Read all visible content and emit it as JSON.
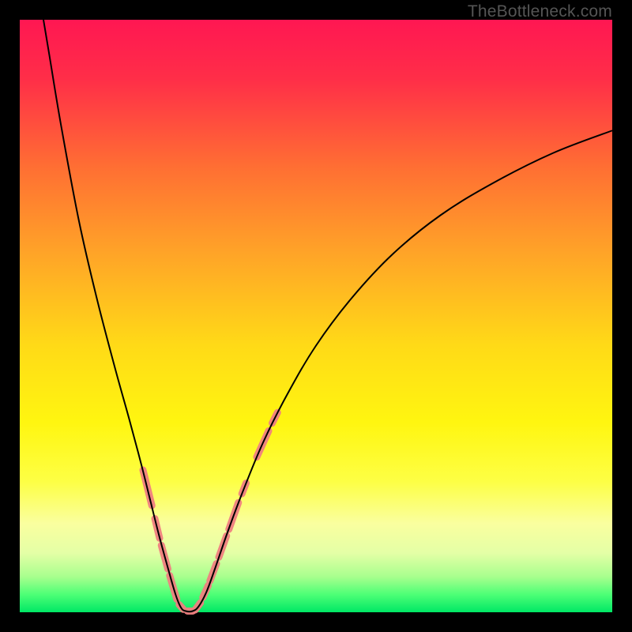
{
  "watermark": "TheBottleneck.com",
  "chart_data": {
    "type": "line",
    "title": "",
    "xlabel": "",
    "ylabel": "",
    "xlim": [
      0,
      100
    ],
    "ylim": [
      0,
      100
    ],
    "gradient_stops": [
      {
        "offset": 0.0,
        "color": "#ff1752"
      },
      {
        "offset": 0.1,
        "color": "#ff2e48"
      },
      {
        "offset": 0.25,
        "color": "#ff6f33"
      },
      {
        "offset": 0.4,
        "color": "#ffa627"
      },
      {
        "offset": 0.55,
        "color": "#ffda17"
      },
      {
        "offset": 0.68,
        "color": "#fff610"
      },
      {
        "offset": 0.78,
        "color": "#fdff45"
      },
      {
        "offset": 0.85,
        "color": "#faff9f"
      },
      {
        "offset": 0.9,
        "color": "#e4ffa6"
      },
      {
        "offset": 0.94,
        "color": "#a8ff8e"
      },
      {
        "offset": 0.97,
        "color": "#4dff76"
      },
      {
        "offset": 1.0,
        "color": "#00e765"
      }
    ],
    "series": [
      {
        "name": "bottleneck-curve",
        "stroke": "#000000",
        "stroke_width": 2,
        "points": [
          {
            "x": 4.0,
            "y": 100.0
          },
          {
            "x": 5.0,
            "y": 94.0
          },
          {
            "x": 7.0,
            "y": 82.0
          },
          {
            "x": 10.0,
            "y": 66.0
          },
          {
            "x": 13.0,
            "y": 53.0
          },
          {
            "x": 16.0,
            "y": 41.5
          },
          {
            "x": 18.5,
            "y": 32.5
          },
          {
            "x": 20.5,
            "y": 25.0
          },
          {
            "x": 22.0,
            "y": 19.0
          },
          {
            "x": 23.5,
            "y": 13.0
          },
          {
            "x": 25.0,
            "y": 7.5
          },
          {
            "x": 26.3,
            "y": 3.0
          },
          {
            "x": 27.2,
            "y": 0.8
          },
          {
            "x": 28.0,
            "y": 0.2
          },
          {
            "x": 29.2,
            "y": 0.2
          },
          {
            "x": 30.2,
            "y": 1.0
          },
          {
            "x": 31.5,
            "y": 3.4
          },
          {
            "x": 33.0,
            "y": 7.5
          },
          {
            "x": 35.0,
            "y": 13.3
          },
          {
            "x": 37.5,
            "y": 20.0
          },
          {
            "x": 41.0,
            "y": 28.5
          },
          {
            "x": 45.0,
            "y": 36.5
          },
          {
            "x": 50.0,
            "y": 45.0
          },
          {
            "x": 56.0,
            "y": 53.0
          },
          {
            "x": 63.0,
            "y": 60.5
          },
          {
            "x": 71.0,
            "y": 67.0
          },
          {
            "x": 80.0,
            "y": 72.5
          },
          {
            "x": 90.0,
            "y": 77.5
          },
          {
            "x": 100.0,
            "y": 81.3
          }
        ]
      }
    ],
    "highlight_segments": {
      "color": "#f08080",
      "stroke_width": 9,
      "segments": [
        [
          {
            "x": 20.8,
            "y": 24.0
          },
          {
            "x": 22.3,
            "y": 18.0
          }
        ],
        [
          {
            "x": 22.8,
            "y": 15.8
          },
          {
            "x": 23.6,
            "y": 12.5
          }
        ],
        [
          {
            "x": 23.9,
            "y": 11.3
          },
          {
            "x": 25.0,
            "y": 7.3
          }
        ],
        [
          {
            "x": 25.3,
            "y": 6.2
          },
          {
            "x": 26.5,
            "y": 2.2
          }
        ],
        [
          {
            "x": 26.9,
            "y": 1.3
          },
          {
            "x": 27.6,
            "y": 0.5
          }
        ],
        [
          {
            "x": 28.3,
            "y": 0.2
          },
          {
            "x": 29.2,
            "y": 0.2
          }
        ],
        [
          {
            "x": 29.6,
            "y": 0.4
          },
          {
            "x": 30.5,
            "y": 1.6
          }
        ],
        [
          {
            "x": 30.9,
            "y": 2.5
          },
          {
            "x": 31.8,
            "y": 4.5
          }
        ],
        [
          {
            "x": 32.1,
            "y": 5.3
          },
          {
            "x": 33.2,
            "y": 8.2
          }
        ],
        [
          {
            "x": 33.6,
            "y": 9.3
          },
          {
            "x": 34.9,
            "y": 12.9
          }
        ],
        [
          {
            "x": 35.3,
            "y": 14.0
          },
          {
            "x": 36.9,
            "y": 18.5
          }
        ],
        [
          {
            "x": 37.5,
            "y": 20.0
          },
          {
            "x": 38.2,
            "y": 21.8
          }
        ],
        [
          {
            "x": 40.0,
            "y": 26.2
          },
          {
            "x": 42.0,
            "y": 30.6
          }
        ],
        [
          {
            "x": 42.6,
            "y": 31.9
          },
          {
            "x": 43.5,
            "y": 33.7
          }
        ]
      ]
    }
  }
}
